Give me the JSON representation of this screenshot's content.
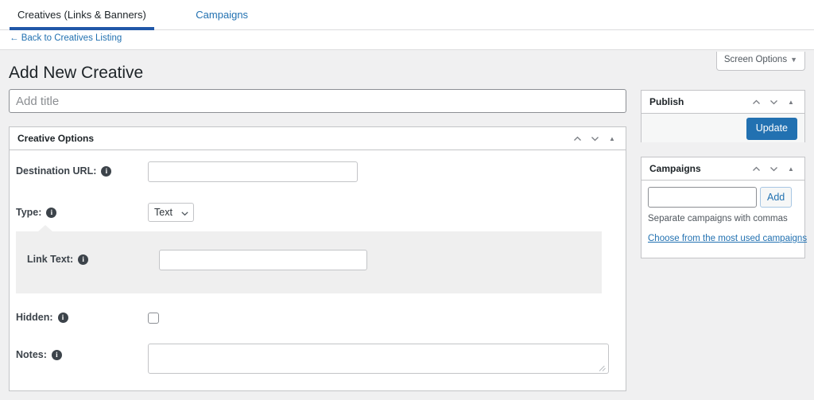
{
  "nav": {
    "tabs": [
      {
        "label": "Creatives (Links & Banners)",
        "active": true
      },
      {
        "label": "Campaigns",
        "active": false
      }
    ],
    "back_link": "← Back to Creatives Listing"
  },
  "screen_options": {
    "label": "Screen Options",
    "caret": "▼"
  },
  "page": {
    "title": "Add New Creative",
    "title_input_value": "",
    "title_input_placeholder": "Add title"
  },
  "creative_options": {
    "panel_title": "Creative Options",
    "controls": {
      "up": "⌃",
      "down": "⌄",
      "toggle": "▲"
    },
    "fields": {
      "destination_url": {
        "label": "Destination URL:",
        "info": "i",
        "value": ""
      },
      "type": {
        "label": "Type:",
        "info": "i",
        "selected": "Text",
        "caret": "⌄"
      },
      "link_text": {
        "label": "Link Text:",
        "info": "i",
        "value": ""
      },
      "hidden": {
        "label": "Hidden:",
        "info": "i",
        "checked": false
      },
      "notes": {
        "label": "Notes:",
        "info": "i",
        "value": ""
      }
    }
  },
  "publish": {
    "panel_title": "Publish",
    "controls": {
      "up": "⌃",
      "down": "⌄",
      "toggle": "▲"
    },
    "update_label": "Update"
  },
  "campaigns": {
    "panel_title": "Campaigns",
    "controls": {
      "up": "⌃",
      "down": "⌄",
      "toggle": "▲"
    },
    "input_value": "",
    "add_label": "Add",
    "help_text": "Separate campaigns with commas",
    "link_text": "Choose from the most used campaigns"
  },
  "colors": {
    "accent_blue": "#2271b1",
    "tab_underline": "#2057a8",
    "page_bg": "#f0f0f1",
    "panel_border": "#c3c4c7",
    "subpanel_bg": "#efefef"
  }
}
